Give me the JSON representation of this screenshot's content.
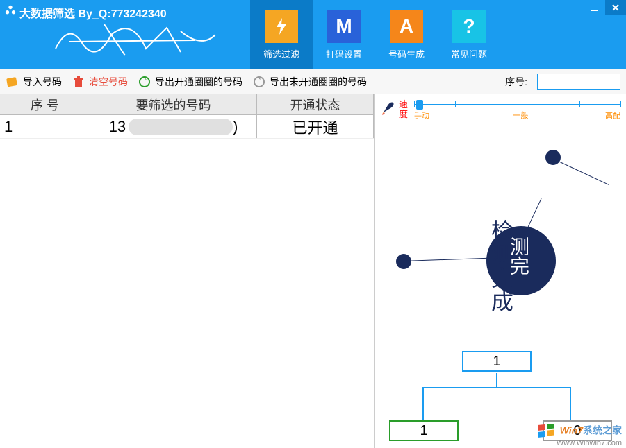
{
  "title": "大数据筛选 By_Q:773242340",
  "nav": {
    "filter": "筛选过滤",
    "captcha": "打码设置",
    "generate": "号码生成",
    "faq": "常见问题"
  },
  "toolbar": {
    "import": "导入号码",
    "clear": "清空号码",
    "export_opened": "导出开通圈圈的号码",
    "export_unopened": "导出未开通圈圈的号码",
    "seq_label": "序号:"
  },
  "table": {
    "headers": {
      "seq": "序 号",
      "number": "要筛选的号码",
      "status": "开通状态"
    },
    "rows": [
      {
        "seq": "1",
        "number_prefix": "13",
        "number_suffix": ")",
        "status": "已开通"
      }
    ]
  },
  "speed": {
    "label": "速度",
    "ticks": {
      "manual": "手动",
      "normal": "一般",
      "high": "高配"
    }
  },
  "detection": {
    "vert_text": "检测完成",
    "circle_text": "测完"
  },
  "tree": {
    "top": "1",
    "left": "1",
    "right": "0"
  },
  "watermark": {
    "brand_a": "Win7",
    "brand_b": "系统之家",
    "url": "Www.Winwin7.com"
  },
  "colors": {
    "primary": "#1a9cf0",
    "darkblue": "#1a2b5c",
    "orange": "#ff8c00",
    "green": "#2a9d2a"
  }
}
